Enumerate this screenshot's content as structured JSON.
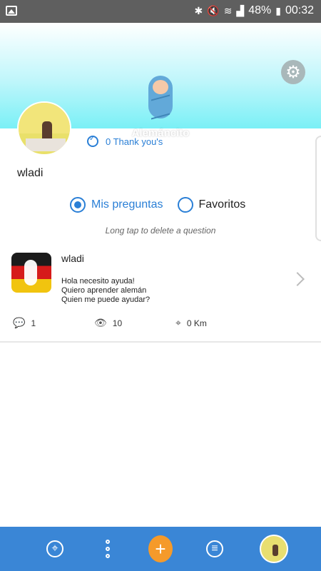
{
  "status_bar": {
    "battery": "48%",
    "time": "00:32",
    "icons": [
      "image-icon",
      "bluetooth-icon",
      "mute-icon",
      "wifi-icon",
      "signal-icon",
      "battery-icon"
    ]
  },
  "profile": {
    "level_name": "Alemáncito",
    "thank_yous": "0 Thank you's",
    "username": "wladi"
  },
  "tabs": {
    "mine_label": "Mis preguntas",
    "favorites_label": "Favoritos",
    "selected": "Mis preguntas"
  },
  "hint": "Long tap to delete a question",
  "question": {
    "author": "wladi",
    "lines": [
      "Hola necesito ayuda!",
      "Quiero aprender alemán",
      "Quien me puede ayudar?"
    ],
    "comments": "1",
    "views": "10",
    "distance": "0 Km"
  },
  "bottom_nav": {
    "items": [
      "map-pin-icon",
      "more-vert-icon",
      "add-icon",
      "list-icon",
      "profile-avatar"
    ]
  },
  "colors": {
    "accent": "#2a7fd6",
    "nav_bar": "#3a86d6",
    "add_button": "#f59a2a",
    "header_cyan": "#7af0f6"
  }
}
